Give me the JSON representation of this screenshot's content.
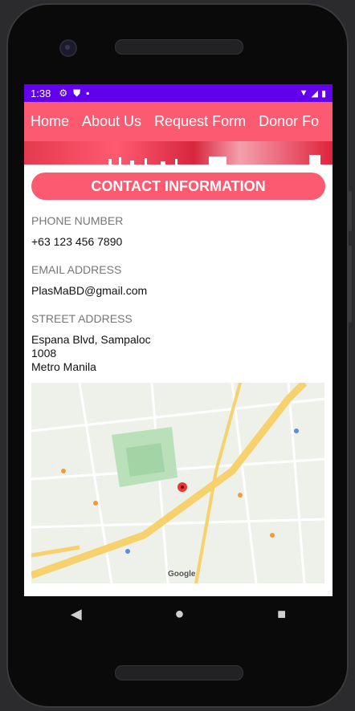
{
  "status_bar": {
    "time": "1:38"
  },
  "nav": {
    "items": [
      "Home",
      "About Us",
      "Request Form",
      "Donor Fo"
    ]
  },
  "contact": {
    "title": "CONTACT INFORMATION",
    "phone_label": "PHONE NUMBER",
    "phone_value": "+63 123 456 7890",
    "email_label": "EMAIL ADDRESS",
    "email_value": "PlasMaBD@gmail.com",
    "address_label": "STREET ADDRESS",
    "address_line1": "Espana Blvd, Sampaloc",
    "address_line2": "1008",
    "address_line3": "Metro Manila"
  },
  "map": {
    "credit": "Google"
  },
  "colors": {
    "accent": "#fb5a70",
    "status_bar": "#6200ee"
  }
}
